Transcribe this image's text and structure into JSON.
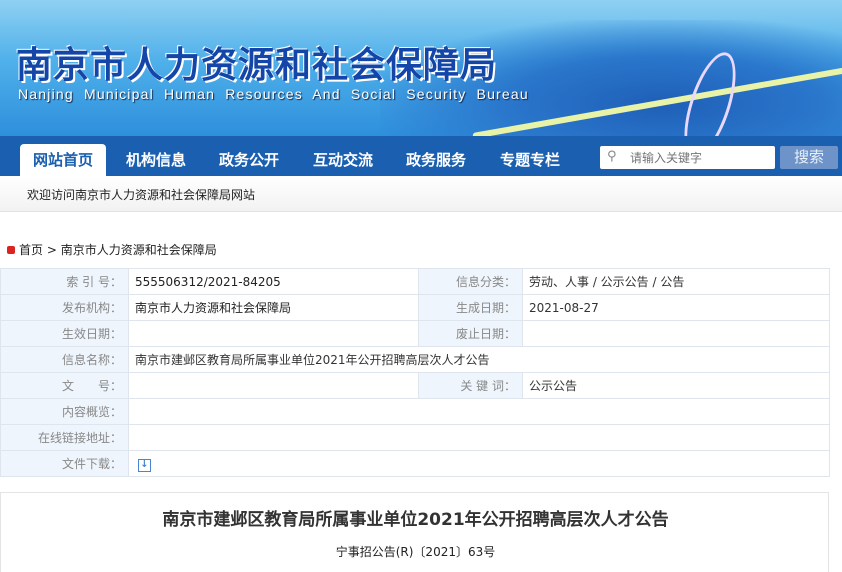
{
  "header": {
    "title": "南京市人力资源和社会保障局",
    "subtitle": "Nanjing Municipal Human Resources And Social Security Bureau"
  },
  "nav": {
    "items": [
      {
        "label": "网站首页",
        "active": true
      },
      {
        "label": "机构信息"
      },
      {
        "label": "政务公开"
      },
      {
        "label": "互动交流"
      },
      {
        "label": "政务服务"
      },
      {
        "label": "专题专栏"
      }
    ],
    "search_placeholder": "请输入关键字",
    "search_button": "搜索",
    "accent": "#1b5fb0"
  },
  "welcome": "欢迎访问南京市人力资源和社会保障局网站",
  "breadcrumb": {
    "home": "首页",
    "sep": ">",
    "current": "南京市人力资源和社会保障局"
  },
  "info": {
    "index_label": "索 引 号：",
    "index": "555506312/2021-84205",
    "category_label": "信息分类：",
    "category": "劳动、人事 / 公示公告 / 公告",
    "publisher_label": "发布机构：",
    "publisher": "南京市人力资源和社会保障局",
    "created_label": "生成日期：",
    "created": "2021-08-27",
    "effective_label": "生效日期：",
    "effective": "",
    "expire_label": "废止日期：",
    "expire": "",
    "name_label": "信息名称：",
    "name": "南京市建邺区教育局所属事业单位2021年公开招聘高层次人才公告",
    "docno_label": "文　　号：",
    "docno": "",
    "keywords_label": "关 键 词：",
    "keywords": "公示公告",
    "summary_label": "内容概览：",
    "summary": "",
    "link_label": "在线链接地址：",
    "link": "",
    "download_label": "文件下载："
  },
  "doc": {
    "title": "南京市建邺区教育局所属事业单位2021年公开招聘高层次人才公告",
    "number": "宁事招公告(R)〔2021〕63号"
  }
}
